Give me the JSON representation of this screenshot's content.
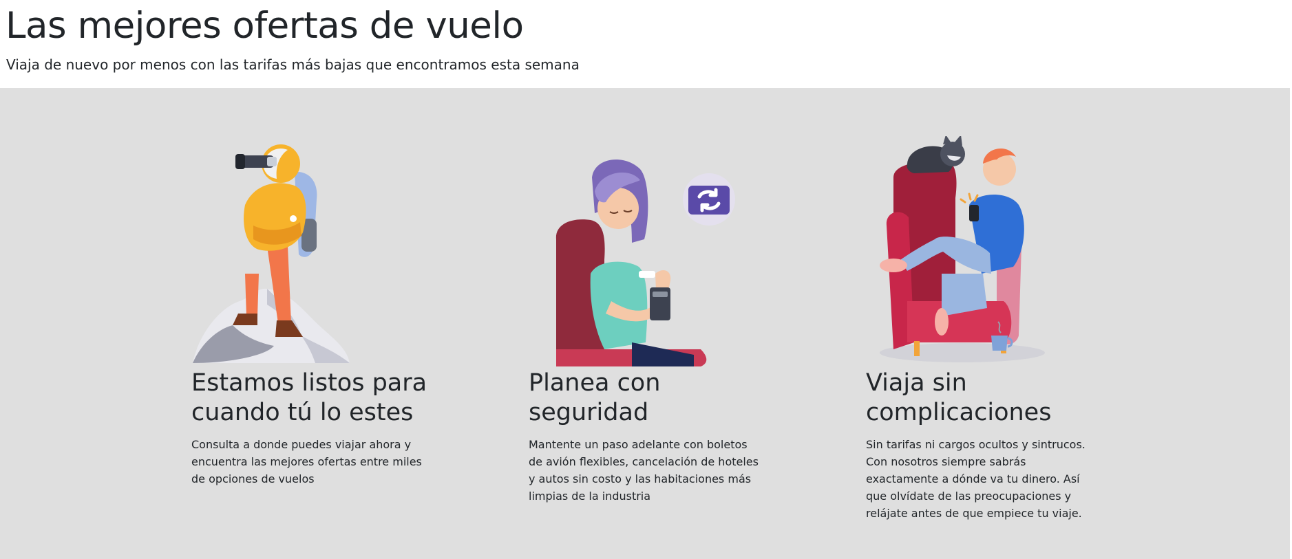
{
  "header": {
    "title": "Las mejores ofertas de vuelo",
    "subtitle": "Viaja de nuevo por menos con las tarifas más bajas que encontramos esta semana"
  },
  "features": [
    {
      "illustration": "hiker-binoculars-illustration",
      "title": "Estamos listos para cuando tú lo estes",
      "description": "Consulta a donde puedes viajar ahora y encuentra las mejores ofertas entre miles de opciones de vuelos"
    },
    {
      "illustration": "woman-phone-exchange-illustration",
      "title": "Planea con seguridad",
      "description": "Mantente un paso adelante con boletos de avión flexibles, cancelación de hoteles y autos sin costo y las habitaciones más limpias de la industria"
    },
    {
      "illustration": "man-armchair-dog-illustration",
      "title": "Viaja sin complicaciones",
      "description": "Sin tarifas ni cargos ocultos y sintrucos. Con nosotros siempre sabrás exactamente a dónde va tu dinero. Así que olvídate de las preocupaciones y relájate antes de que empiece tu viaje."
    }
  ],
  "colors": {
    "band_background": "#dfdfdf",
    "text": "#212529"
  }
}
